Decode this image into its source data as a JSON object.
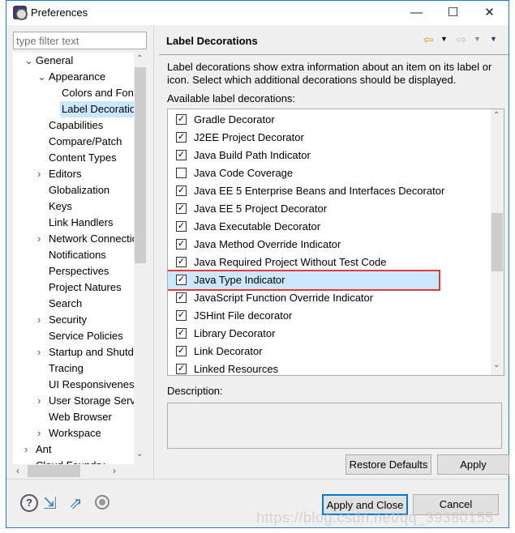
{
  "window": {
    "title": "Preferences",
    "minimize": "—",
    "maximize": "☐",
    "close": "✕"
  },
  "filter": {
    "placeholder": "type filter text"
  },
  "tree": [
    {
      "label": "General",
      "level": 0,
      "state": "expanded"
    },
    {
      "label": "Appearance",
      "level": 1,
      "state": "expanded"
    },
    {
      "label": "Colors and Fonts",
      "level": 2,
      "state": "leaf"
    },
    {
      "label": "Label Decorations",
      "level": 2,
      "state": "leaf",
      "selected": true
    },
    {
      "label": "Capabilities",
      "level": 1,
      "state": "leaf"
    },
    {
      "label": "Compare/Patch",
      "level": 1,
      "state": "leaf"
    },
    {
      "label": "Content Types",
      "level": 1,
      "state": "leaf"
    },
    {
      "label": "Editors",
      "level": 1,
      "state": "collapsed"
    },
    {
      "label": "Globalization",
      "level": 1,
      "state": "leaf"
    },
    {
      "label": "Keys",
      "level": 1,
      "state": "leaf"
    },
    {
      "label": "Link Handlers",
      "level": 1,
      "state": "leaf"
    },
    {
      "label": "Network Connections",
      "level": 1,
      "state": "collapsed"
    },
    {
      "label": "Notifications",
      "level": 1,
      "state": "leaf"
    },
    {
      "label": "Perspectives",
      "level": 1,
      "state": "leaf"
    },
    {
      "label": "Project Natures",
      "level": 1,
      "state": "leaf"
    },
    {
      "label": "Search",
      "level": 1,
      "state": "leaf"
    },
    {
      "label": "Security",
      "level": 1,
      "state": "collapsed"
    },
    {
      "label": "Service Policies",
      "level": 1,
      "state": "leaf"
    },
    {
      "label": "Startup and Shutdown",
      "level": 1,
      "state": "collapsed"
    },
    {
      "label": "Tracing",
      "level": 1,
      "state": "leaf"
    },
    {
      "label": "UI Responsiveness",
      "level": 1,
      "state": "leaf"
    },
    {
      "label": "User Storage Service",
      "level": 1,
      "state": "collapsed"
    },
    {
      "label": "Web Browser",
      "level": 1,
      "state": "leaf"
    },
    {
      "label": "Workspace",
      "level": 1,
      "state": "collapsed"
    },
    {
      "label": "Ant",
      "level": 0,
      "state": "collapsed"
    },
    {
      "label": "Cloud Foundry",
      "level": 0,
      "state": "collapsed"
    }
  ],
  "page": {
    "title": "Label Decorations",
    "description": "Label decorations show extra information about an item on its label or icon. Select which additional decorations should be displayed.",
    "available_label": "Available label decorations:",
    "decorations": [
      {
        "label": "Gradle Decorator",
        "checked": true
      },
      {
        "label": "J2EE Project Decorator",
        "checked": true
      },
      {
        "label": "Java Build Path Indicator",
        "checked": true
      },
      {
        "label": "Java Code Coverage",
        "checked": false
      },
      {
        "label": "Java EE 5 Enterprise Beans and Interfaces Decorator",
        "checked": true
      },
      {
        "label": "Java EE 5 Project Decorator",
        "checked": true
      },
      {
        "label": "Java Executable Decorator",
        "checked": true
      },
      {
        "label": "Java Method Override Indicator",
        "checked": true
      },
      {
        "label": "Java Required Project Without Test Code",
        "checked": true
      },
      {
        "label": "Java Type Indicator",
        "checked": true,
        "selected": true,
        "highlighted": true
      },
      {
        "label": "JavaScript Function Override Indicator",
        "checked": true
      },
      {
        "label": "JSHint File decorator",
        "checked": true
      },
      {
        "label": "Library Decorator",
        "checked": true
      },
      {
        "label": "Link Decorator",
        "checked": true
      },
      {
        "label": "Linked Resources",
        "checked": true
      }
    ],
    "description_label": "Description:",
    "restore_defaults": "Restore Defaults",
    "apply": "Apply"
  },
  "footer": {
    "apply_close": "Apply and Close",
    "cancel": "Cancel"
  },
  "watermark": "https://blog.csdn.net/qq_39380155",
  "colors": {
    "highlight_box": "#e53935",
    "selection": "#cce8ff",
    "accent": "#0078d7"
  }
}
